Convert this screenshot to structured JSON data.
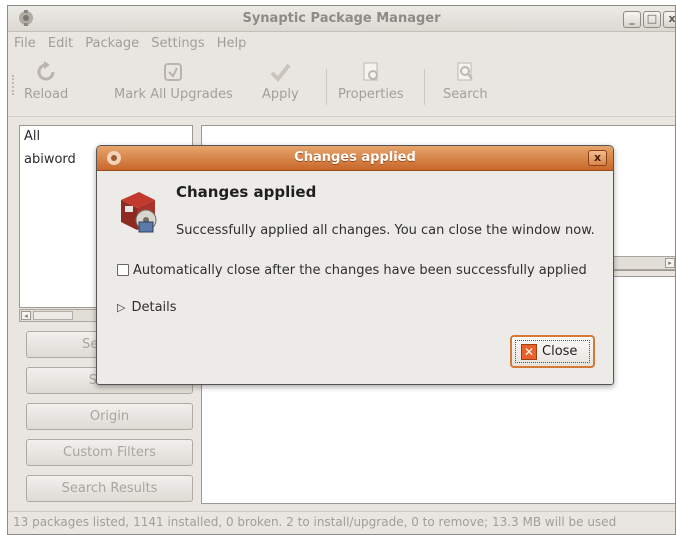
{
  "window": {
    "title": "Synaptic Package Manager",
    "controls": {
      "minimize": "_",
      "maximize": "□",
      "close": "x"
    }
  },
  "menu": [
    "File",
    "Edit",
    "Package",
    "Settings",
    "Help"
  ],
  "toolbar": {
    "reload": "Reload",
    "mark_all_upgrades": "Mark All Upgrades",
    "apply": "Apply",
    "properties": "Properties",
    "search": "Search"
  },
  "filters": {
    "items": [
      "All",
      "abiword"
    ]
  },
  "side_buttons": {
    "sections": "Sections",
    "status": "Status",
    "origin": "Origin",
    "custom_filters": "Custom Filters",
    "search_results": "Search Results"
  },
  "statusbar": {
    "text": "13 packages listed, 1141 installed, 0 broken. 2 to install/upgrade, 0 to remove; 13.3 MB will be used"
  },
  "dialog": {
    "title": "Changes applied",
    "heading": "Changes applied",
    "message": "Successfully applied all changes. You can close the window now.",
    "auto_close_label": "Automatically close after the changes have been successfully applied",
    "auto_close_checked": false,
    "details_label": "Details",
    "close_button": "Close",
    "close_x": "x"
  },
  "colors": {
    "dialog_titlebar": "#d57a36",
    "window_bg": "#e9e6e1"
  }
}
